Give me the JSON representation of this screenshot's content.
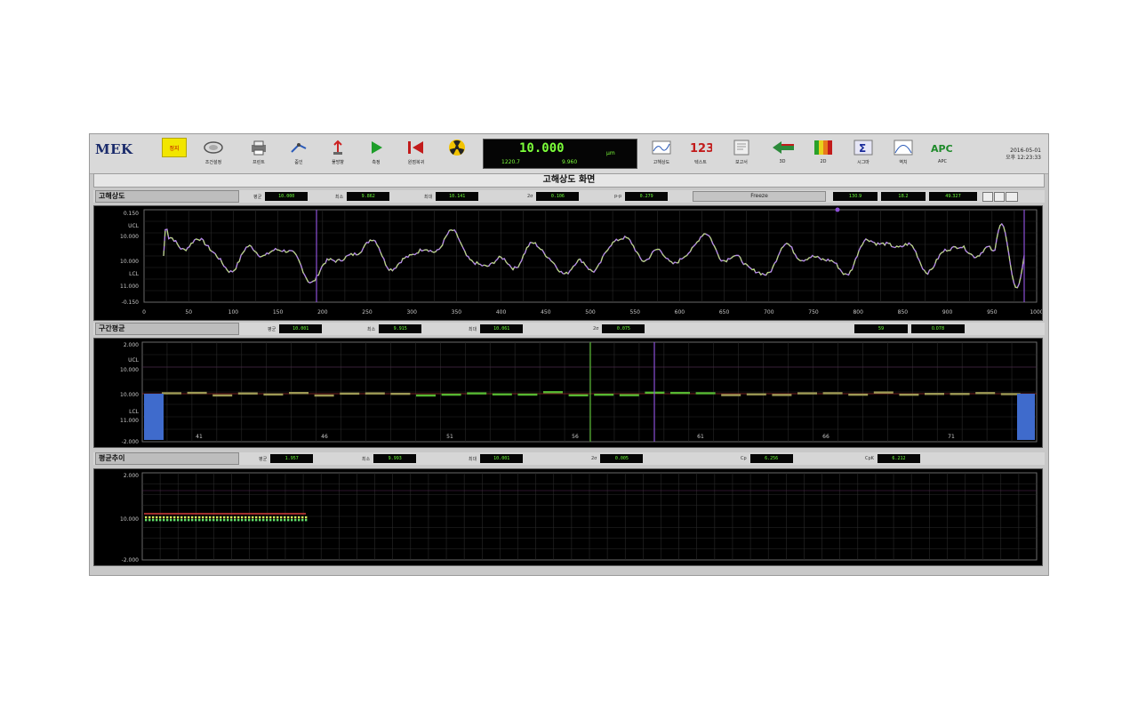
{
  "toolbar": {
    "logo": "MEK",
    "logo_sub": "",
    "stop_label": "정지",
    "left_buttons": [
      {
        "label": "조건설정",
        "icon": "settings-lens-icon"
      },
      {
        "label": "프린트",
        "icon": "printer-icon"
      },
      {
        "label": "줌인",
        "icon": "zoom-in-icon"
      },
      {
        "label": "풀방향",
        "icon": "direction-icon"
      },
      {
        "label": "측정",
        "icon": "play-icon"
      },
      {
        "label": "원점복귀",
        "icon": "return-origin-icon"
      },
      {
        "label": "",
        "icon": "radiation-icon"
      }
    ],
    "right_buttons": [
      {
        "label": "고해상도",
        "icon": "trend-chart-icon"
      },
      {
        "label": "텍스트",
        "icon": "numbers-123-icon"
      },
      {
        "label": "보고서",
        "icon": "report-icon"
      },
      {
        "label": "3D",
        "icon": "3d-arrow-icon"
      },
      {
        "label": "2D",
        "icon": "2d-colormap-icon"
      },
      {
        "label": "시그마",
        "icon": "sigma-icon"
      },
      {
        "label": "역치",
        "icon": "histogram-icon"
      },
      {
        "label": "APC",
        "icon": "apc-icon"
      }
    ],
    "readout": {
      "value": "10.000",
      "unit": "μm",
      "sub1": "1220.7",
      "sub2": "9.960"
    },
    "datetime": {
      "date": "2016-05-01",
      "time": "오후 12:23:33"
    }
  },
  "title": "고해상도 화면",
  "sections": {
    "high_res": {
      "name": "고해상도",
      "stats": [
        {
          "k": "평균",
          "v": "10.000"
        },
        {
          "k": "최소",
          "v": "9.862"
        },
        {
          "k": "최대",
          "v": "10.141"
        },
        {
          "k": "2σ",
          "v": "0.106"
        },
        {
          "k": "p-p",
          "v": "0.279"
        }
      ],
      "freeze": "Freeze",
      "mini": [
        "130.9",
        "18.2",
        "49.327"
      ],
      "y_labels": [
        "0.150",
        "UCL",
        "10.000",
        "10.000",
        "LCL",
        "11.000",
        "-0.150"
      ],
      "x_labels": [
        "0",
        "50",
        "100",
        "150",
        "200",
        "250",
        "300",
        "350",
        "400",
        "450",
        "500",
        "550",
        "600",
        "650",
        "700",
        "750",
        "800",
        "850",
        "900",
        "950",
        "1000"
      ]
    },
    "segment_avg": {
      "name": "구간평균",
      "stats": [
        {
          "k": "평균",
          "v": "10.001"
        },
        {
          "k": "최소",
          "v": "9.915"
        },
        {
          "k": "최대",
          "v": "10.061"
        },
        {
          "k": "2σ",
          "v": "0.075"
        }
      ],
      "mini": [
        "59",
        "0.078"
      ],
      "y_labels": [
        "2.000",
        "UCL",
        "10.000",
        "10.000",
        "LCL",
        "11.000",
        "-2.000"
      ],
      "x_labels": [
        "41",
        "46",
        "51",
        "56",
        "61",
        "66",
        "71"
      ]
    },
    "mean_trend": {
      "name": "평균추이",
      "stats": [
        {
          "k": "평균",
          "v": "1.957"
        },
        {
          "k": "최소",
          "v": "9.993"
        },
        {
          "k": "최대",
          "v": "10.001"
        },
        {
          "k": "2σ",
          "v": "0.005"
        },
        {
          "k": "Cp",
          "v": "6.256"
        },
        {
          "k": "CpK",
          "v": "6.212"
        }
      ],
      "y_labels": [
        "2.000",
        "10.000",
        "-2.000"
      ]
    }
  },
  "colors": {
    "plot_bg": "#000000",
    "grid": "#2a2a2a",
    "trace_a": "#b6e36a",
    "trace_b": "#b58ae6",
    "ref": "#9b2c2c",
    "marker": "#8b4fd6",
    "bar": "#56b832",
    "end_bar": "#3f6bcc"
  }
}
